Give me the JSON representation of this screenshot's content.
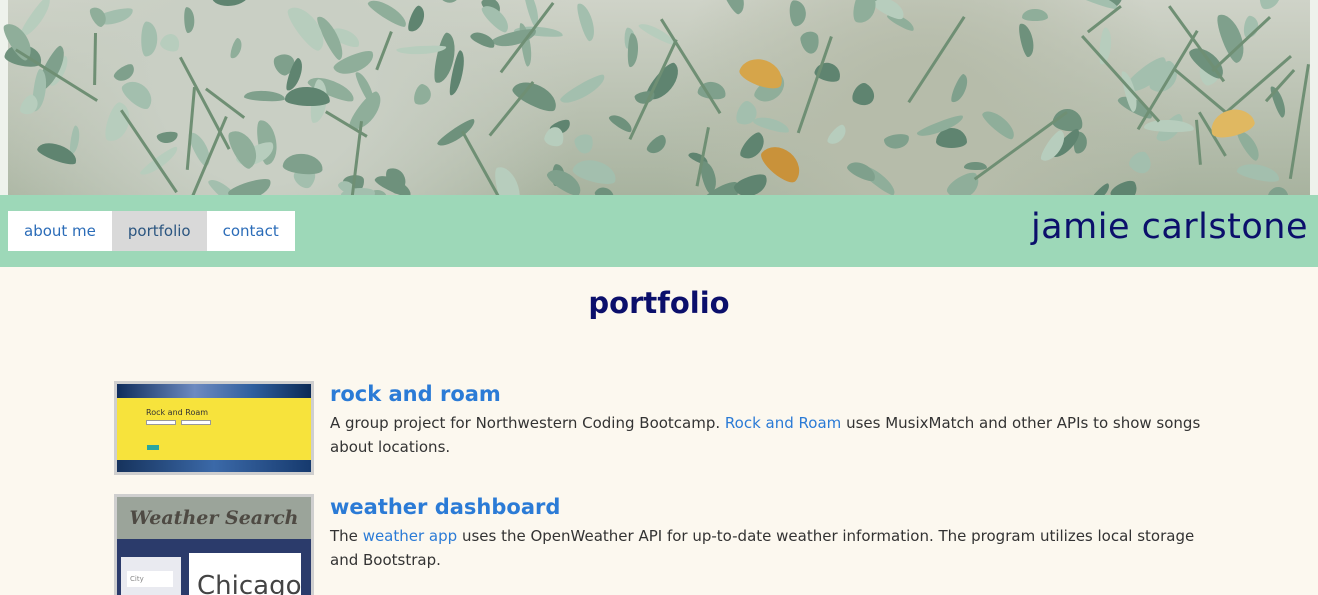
{
  "nav": {
    "items": [
      {
        "label": "about me",
        "active": false
      },
      {
        "label": "portfolio",
        "active": true
      },
      {
        "label": "contact",
        "active": false
      }
    ]
  },
  "brand": "jamie carlstone",
  "main": {
    "title": "portfolio",
    "projects": [
      {
        "title": "rock and roam",
        "desc_before": "A group project for Northwestern Coding Bootcamp.",
        "link_text": "Rock and Roam",
        "desc_after": "uses MusixMatch and other APIs to show songs about locations.",
        "thumb": {
          "heading": "Rock and Roam"
        }
      },
      {
        "title": "weather dashboard",
        "desc_before": "The",
        "link_text": "weather app",
        "desc_after": "uses the OpenWeather API for up-to-date weather information. The program utilizes local storage and Bootstrap.",
        "thumb": {
          "heading": "Weather Search",
          "field_placeholder": "City",
          "city": "Chicago"
        }
      }
    ]
  },
  "colors": {
    "nav_bg": "#9dd8b8",
    "page_bg": "#fcf8ef",
    "heading": "#0b0f6b",
    "link": "#2b7bd6"
  }
}
